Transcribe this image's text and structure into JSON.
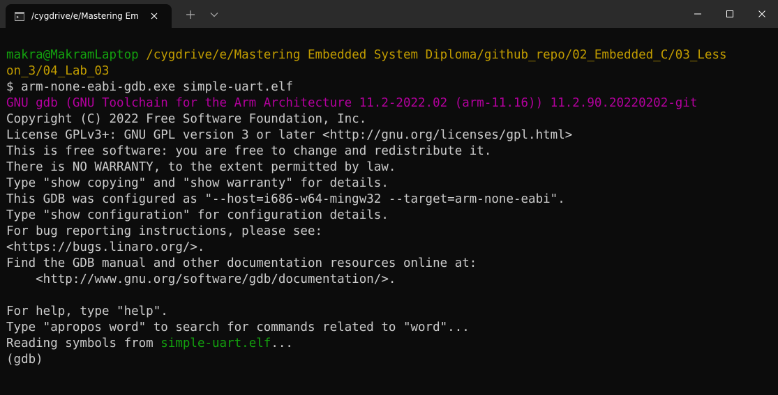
{
  "tab": {
    "title": "/cygdrive/e/Mastering Embedded",
    "icon": "terminal-icon"
  },
  "titlebar": {
    "new_tab_icon": "plus-icon",
    "dropdown_icon": "chevron-down-icon",
    "minimize_icon": "minimize-icon",
    "maximize_icon": "maximize-icon",
    "close_icon": "close-icon"
  },
  "colors": {
    "background": "#0c0c0c",
    "titlebar": "#2b2b2b",
    "text": "#cccccc",
    "prompt_user": "#13a10e",
    "prompt_path": "#c19c00",
    "gdb_banner": "#b4009e",
    "filename": "#13a10e"
  },
  "terminal": {
    "prompt_user": "makra@MakramLaptop",
    "prompt_path_line1": "/cygdrive/e/Mastering Embedded System Diploma/github_repo/02_Embedded_C/03_Less",
    "prompt_path_line2": "on_3/04_Lab_03",
    "command": "$ arm-none-eabi-gdb.exe simple-uart.elf",
    "gdb_banner": "GNU gdb (GNU Toolchain for the Arm Architecture 11.2-2022.02 (arm-11.16)) 11.2.90.20220202-git",
    "output_lines": [
      "Copyright (C) 2022 Free Software Foundation, Inc.",
      "License GPLv3+: GNU GPL version 3 or later <http://gnu.org/licenses/gpl.html>",
      "This is free software: you are free to change and redistribute it.",
      "There is NO WARRANTY, to the extent permitted by law.",
      "Type \"show copying\" and \"show warranty\" for details.",
      "This GDB was configured as \"--host=i686-w64-mingw32 --target=arm-none-eabi\".",
      "Type \"show configuration\" for configuration details.",
      "For bug reporting instructions, please see:",
      "<https://bugs.linaro.org/>.",
      "Find the GDB manual and other documentation resources online at:",
      "    <http://www.gnu.org/software/gdb/documentation/>.",
      "",
      "For help, type \"help\".",
      "Type \"apropos word\" to search for commands related to \"word\"..."
    ],
    "reading_prefix": "Reading symbols from ",
    "reading_file": "simple-uart.elf",
    "reading_suffix": "...",
    "gdb_prompt": "(gdb)"
  }
}
